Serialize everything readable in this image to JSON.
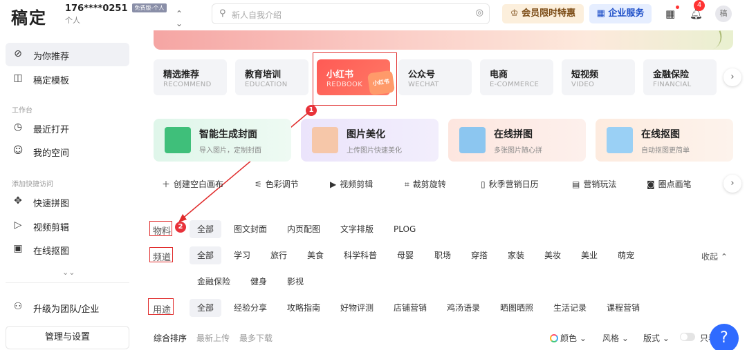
{
  "header": {
    "logo": "稿定",
    "user_phone": "176****0251",
    "user_badge": "免费版-个人",
    "user_kind": "个人",
    "search_placeholder": "新人自我介绍",
    "vip_label": "会员限时特惠",
    "biz_label": "企业服务",
    "notification_count": "4",
    "avatar_text": "稿"
  },
  "sidebar": {
    "items_top": [
      {
        "label": "为你推荐",
        "icon": "compass-icon",
        "active": true
      },
      {
        "label": "稿定模板",
        "icon": "template-icon",
        "active": false
      }
    ],
    "section_workspace": "工作台",
    "items_work": [
      {
        "label": "最近打开",
        "icon": "clock-icon"
      },
      {
        "label": "我的空间",
        "icon": "user-circle-icon"
      }
    ],
    "section_quick": "添加快捷访问",
    "items_quick": [
      {
        "label": "快速拼图",
        "icon": "puzzle-icon"
      },
      {
        "label": "视频剪辑",
        "icon": "play-icon"
      },
      {
        "label": "在线抠图",
        "icon": "cutout-icon"
      }
    ],
    "upgrade_label": "升级为团队/企业",
    "manage_label": "管理与设置"
  },
  "tabs": [
    {
      "title": "精选推荐",
      "sub": "RECOMMEND"
    },
    {
      "title": "教育培训",
      "sub": "EDUCATION"
    },
    {
      "title": "小红书",
      "sub": "REDBOOK",
      "logo": "小红书"
    },
    {
      "title": "公众号",
      "sub": "WECHAT"
    },
    {
      "title": "电商",
      "sub": "E-COMMERCE"
    },
    {
      "title": "短视频",
      "sub": "VIDEO"
    },
    {
      "title": "金融保险",
      "sub": "FINANCIAL"
    }
  ],
  "annotations": {
    "badge1": "1",
    "badge2": "2"
  },
  "features": [
    {
      "title": "智能生成封面",
      "sub": "导入图片，定制封面",
      "color": "#e3f7ee"
    },
    {
      "title": "图片美化",
      "sub": "上传图片快速美化",
      "color": "#ece6fb"
    },
    {
      "title": "在线拼图",
      "sub": "多张图片随心拼",
      "color": "#fde9e2"
    },
    {
      "title": "在线抠图",
      "sub": "自动抠图更简单",
      "color": "#fdeee3"
    }
  ],
  "tools": [
    {
      "label": "创建空白画布",
      "icon": "plus-icon"
    },
    {
      "label": "色彩调节",
      "icon": "sliders-icon"
    },
    {
      "label": "视频剪辑",
      "icon": "video-icon"
    },
    {
      "label": "裁剪旋转",
      "icon": "crop-icon"
    },
    {
      "label": "秋季营销日历",
      "icon": "calendar-icon"
    },
    {
      "label": "营销玩法",
      "icon": "board-icon"
    },
    {
      "label": "圈点画笔",
      "icon": "pen-icon"
    }
  ],
  "filters": {
    "material_label": "物料",
    "material": [
      "全部",
      "图文封面",
      "内页配图",
      "文字排版",
      "PLOG"
    ],
    "channel_label": "频道",
    "channel_row1": [
      "全部",
      "学习",
      "旅行",
      "美食",
      "科学科普",
      "母婴",
      "职场",
      "穿搭",
      "家装",
      "美妆",
      "美业",
      "萌宠"
    ],
    "channel_row2": [
      "金融保险",
      "健身",
      "影视"
    ],
    "collapse_label": "收起",
    "usage_label": "用途",
    "usage": [
      "全部",
      "经验分享",
      "攻略指南",
      "好物评测",
      "店铺营销",
      "鸡汤语录",
      "晒图晒照",
      "生活记录",
      "课程营销"
    ]
  },
  "sort": {
    "options": [
      "综合排序",
      "最新上传",
      "最多下载"
    ],
    "color_label": "颜色",
    "style_label": "风格",
    "layout_label": "版式",
    "only_label": "只看"
  },
  "help_label": "?"
}
